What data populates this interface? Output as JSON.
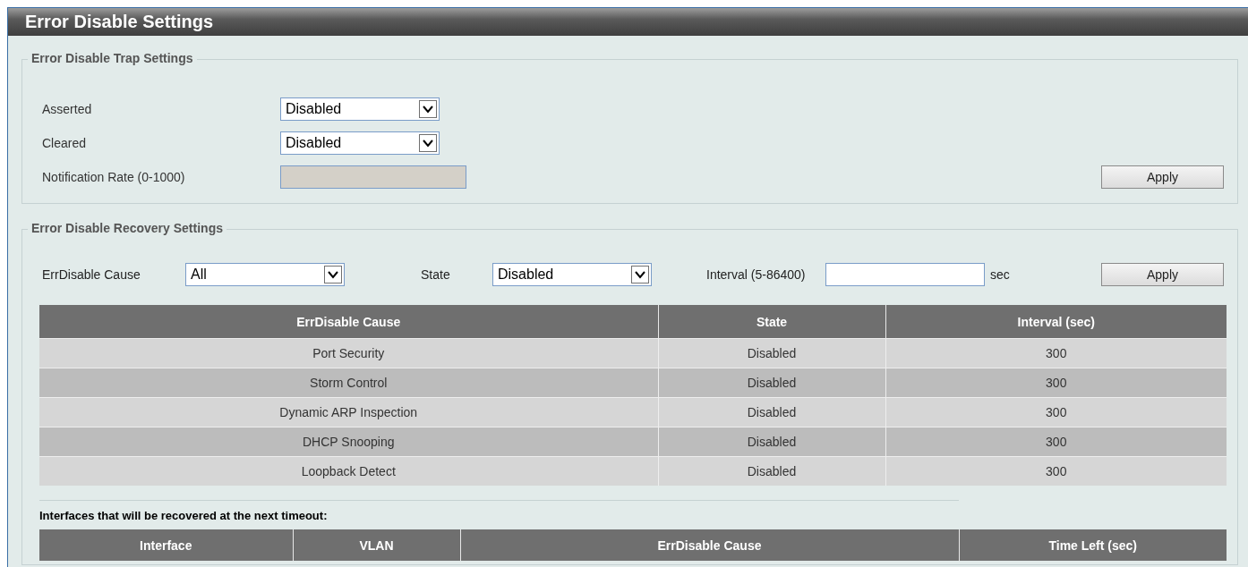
{
  "title": "Error Disable Settings",
  "trap_settings": {
    "legend": "Error Disable Trap Settings",
    "fields": [
      {
        "kind": "select",
        "label": "Asserted",
        "value": "Disabled"
      },
      {
        "kind": "select",
        "label": "Cleared",
        "value": "Disabled"
      },
      {
        "kind": "input",
        "label": "Notification Rate (0-1000)",
        "disabled": true
      }
    ],
    "apply": "Apply"
  },
  "recovery_settings": {
    "legend": "Error Disable Recovery Settings",
    "cause_label": "ErrDisable Cause",
    "cause_value": "All",
    "state_label": "State",
    "state_value": "Disabled",
    "interval_label": "Interval (5-86400)",
    "unit": "sec",
    "apply": "Apply",
    "table": {
      "columns": [
        "ErrDisable Cause",
        "State",
        "Interval (sec)"
      ],
      "rows": [
        [
          "Port Security",
          "Disabled",
          "300"
        ],
        [
          "Storm Control",
          "Disabled",
          "300"
        ],
        [
          "Dynamic ARP Inspection",
          "Disabled",
          "300"
        ],
        [
          "DHCP Snooping",
          "Disabled",
          "300"
        ],
        [
          "Loopback Detect",
          "Disabled",
          "300"
        ]
      ]
    },
    "interfaces": {
      "caption": "Interfaces that will be recovered at the next timeout:",
      "columns": [
        "Interface",
        "VLAN",
        "ErrDisable Cause",
        "Time Left (sec)"
      ]
    }
  }
}
